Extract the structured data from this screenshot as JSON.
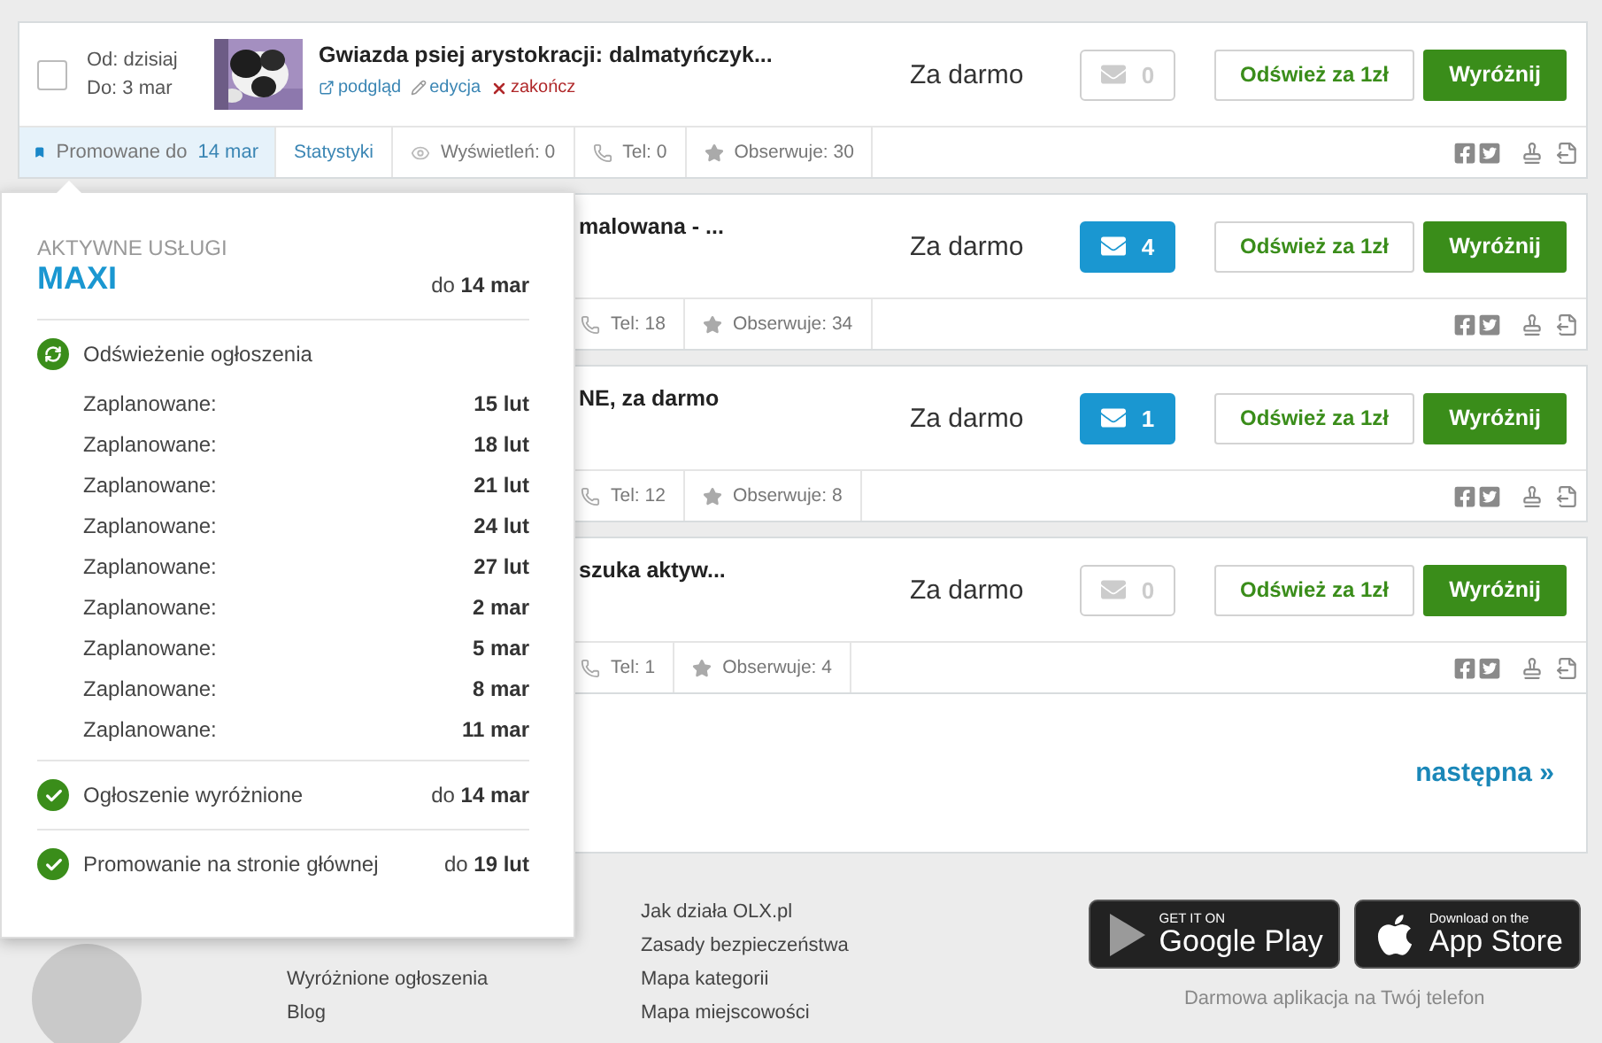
{
  "listings": [
    {
      "kind": "full",
      "checked": false,
      "date_from": "Od: dzisiaj",
      "date_to": "Do: 3 mar",
      "thumbnail": {
        "kind": "picture"
      },
      "title": "Gwiazda psiej arystokracji: dalmatyńczyk...",
      "actions": [
        {
          "kind": "preview",
          "label": "podgląd"
        },
        {
          "kind": "edit",
          "label": "edycja"
        },
        {
          "kind": "end",
          "label": "zakończ"
        }
      ],
      "price": "Za darmo",
      "messages": {
        "count": "0",
        "unread": false
      },
      "refresh": "Odśwież za 1zł",
      "highlight": "Wyróżnij",
      "stats": [
        {
          "kind": "promoted",
          "label": "Promowane do",
          "date": "14 mar",
          "selected": true
        },
        {
          "kind": "link",
          "label": "Statystyki"
        },
        {
          "kind": "views",
          "label": "Wyświetleń: 0"
        },
        {
          "kind": "phone",
          "label": "Tel: 0"
        },
        {
          "kind": "watchers",
          "label": "Obserwuje: 30"
        }
      ]
    },
    {
      "kind": "covered",
      "title": "malowana - ...",
      "price": "Za darmo",
      "messages": {
        "count": "4",
        "unread": true
      },
      "refresh": "Odśwież za 1zł",
      "highlight": "Wyróżnij",
      "stats": [
        {
          "kind": "phone",
          "label": "Tel: 18"
        },
        {
          "kind": "watchers",
          "label": "Obserwuje: 34"
        }
      ]
    },
    {
      "kind": "covered",
      "title": "NE, za darmo",
      "price": "Za darmo",
      "messages": {
        "count": "1",
        "unread": true
      },
      "refresh": "Odśwież za 1zł",
      "highlight": "Wyróżnij",
      "stats": [
        {
          "kind": "phone",
          "label": "Tel: 12"
        },
        {
          "kind": "watchers",
          "label": "Obserwuje: 8"
        }
      ]
    },
    {
      "kind": "covered",
      "title": "szuka aktyw...",
      "price": "Za darmo",
      "messages": {
        "count": "0",
        "unread": false
      },
      "refresh": "Odśwież za 1zł",
      "highlight": "Wyróżnij",
      "stats": [
        {
          "kind": "phone",
          "label": "Tel: 1"
        },
        {
          "kind": "watchers",
          "label": "Obserwuje: 4"
        }
      ]
    }
  ],
  "pagination": {
    "next": "następna »"
  },
  "popover": {
    "heading": "AKTYWNE USŁUGI",
    "package": "MAXI",
    "package_until": "do **14 mar**",
    "services": [
      {
        "kind": "refresh",
        "label": "Odświeżenie ogłoszenia",
        "schedule": [
          {
            "label": "Zaplanowane:",
            "date": "15 lut"
          },
          {
            "label": "Zaplanowane:",
            "date": "18 lut"
          },
          {
            "label": "Zaplanowane:",
            "date": "21 lut"
          },
          {
            "label": "Zaplanowane:",
            "date": "24 lut"
          },
          {
            "label": "Zaplanowane:",
            "date": "27 lut"
          },
          {
            "label": "Zaplanowane:",
            "date": "2 mar"
          },
          {
            "label": "Zaplanowane:",
            "date": "5 mar"
          },
          {
            "label": "Zaplanowane:",
            "date": "8 mar"
          },
          {
            "label": "Zaplanowane:",
            "date": "11 mar"
          }
        ]
      },
      {
        "kind": "active",
        "label": "Ogłoszenie wyróżnione",
        "until": "do **14 mar**"
      },
      {
        "kind": "active",
        "label": "Promowanie na stronie głównej",
        "until": "do **19 lut**"
      }
    ]
  },
  "footer": {
    "columns": [
      [
        "Wyróżnione ogłoszenia",
        "Blog"
      ],
      [
        "Jak działa OLX.pl",
        "Zasady bezpieczeństwa",
        "Mapa kategorii",
        "Mapa miejscowości"
      ]
    ],
    "stores": [
      {
        "kind": "google",
        "small": "GET IT ON",
        "big": "Google Play"
      },
      {
        "kind": "apple",
        "small": "Download on the",
        "big": "App Store"
      }
    ],
    "caption": "Darmowa aplikacja na Twój telefon"
  }
}
